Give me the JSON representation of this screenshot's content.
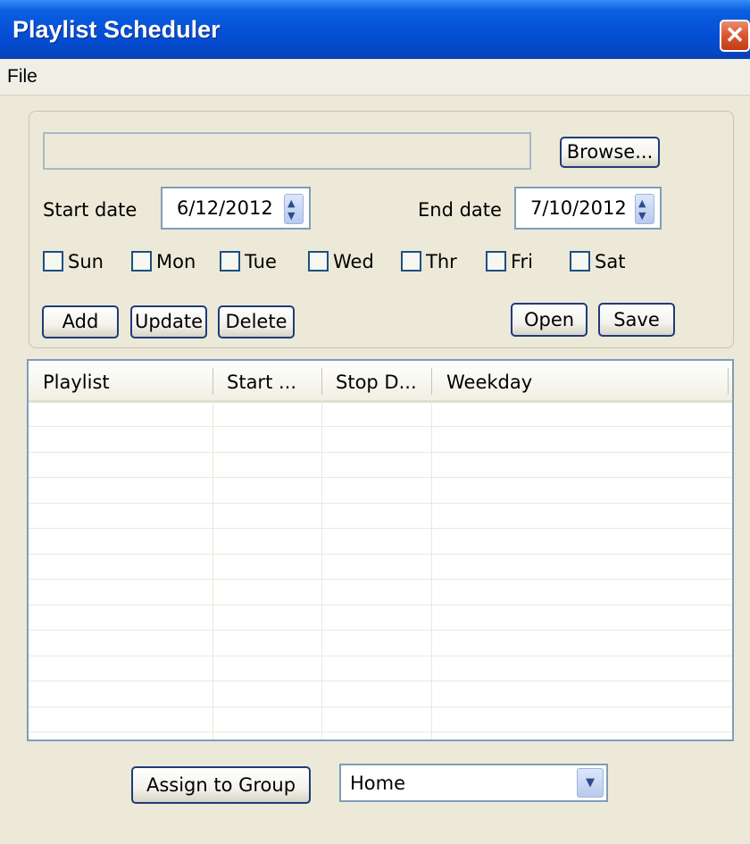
{
  "window": {
    "title": "Playlist Scheduler",
    "close_glyph": "✕"
  },
  "menu": {
    "file": "File"
  },
  "file_picker": {
    "path_value": "",
    "browse_label": "Browse..."
  },
  "dates": {
    "start_label": "Start date",
    "start_value": "6/12/2012",
    "end_label": "End date",
    "end_value": "7/10/2012"
  },
  "weekdays": [
    {
      "label": "Sun",
      "checked": false
    },
    {
      "label": "Mon",
      "checked": false
    },
    {
      "label": "Tue",
      "checked": false
    },
    {
      "label": "Wed",
      "checked": false
    },
    {
      "label": "Thr",
      "checked": false
    },
    {
      "label": "Fri",
      "checked": false
    },
    {
      "label": "Sat",
      "checked": false
    }
  ],
  "buttons": {
    "add": "Add",
    "update": "Update",
    "delete": "Delete",
    "open": "Open",
    "save": "Save"
  },
  "table": {
    "columns": [
      "Playlist",
      "Start ...",
      "Stop D...",
      "Weekday"
    ],
    "rows": []
  },
  "footer": {
    "assign_label": "Assign to Group",
    "group_selected": "Home"
  },
  "icons": {
    "spin_up": "spin-up-icon",
    "spin_down": "spin-down-icon",
    "dropdown": "chevron-down-icon",
    "close": "close-icon"
  },
  "colors": {
    "titlebar": "#0550d6",
    "close": "#d9552e",
    "window_bg": "#ece9d8",
    "border": "#7f9db9"
  }
}
